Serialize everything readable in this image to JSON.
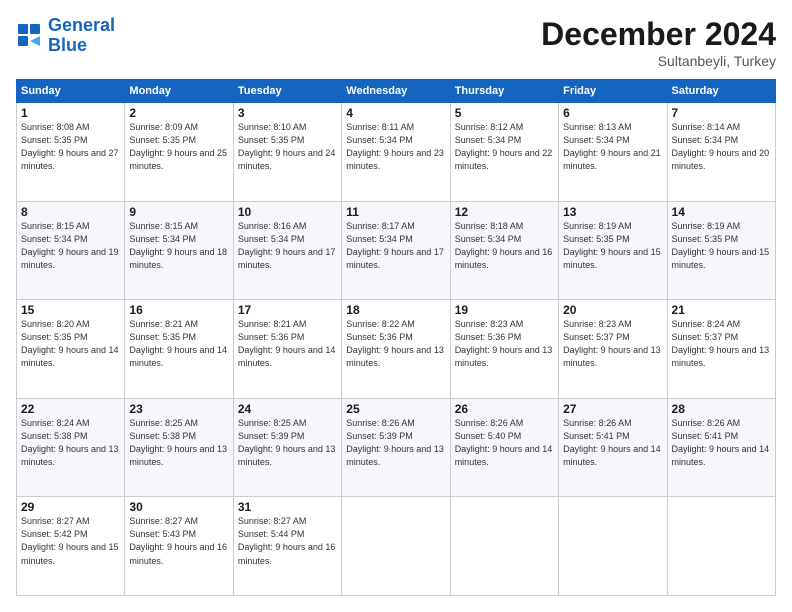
{
  "logo": {
    "line1": "General",
    "line2": "Blue"
  },
  "header": {
    "month_title": "December 2024",
    "subtitle": "Sultanbeyli, Turkey"
  },
  "days_of_week": [
    "Sunday",
    "Monday",
    "Tuesday",
    "Wednesday",
    "Thursday",
    "Friday",
    "Saturday"
  ],
  "weeks": [
    [
      {
        "day": "1",
        "info": "Sunrise: 8:08 AM\nSunset: 5:35 PM\nDaylight: 9 hours and 27 minutes."
      },
      {
        "day": "2",
        "info": "Sunrise: 8:09 AM\nSunset: 5:35 PM\nDaylight: 9 hours and 25 minutes."
      },
      {
        "day": "3",
        "info": "Sunrise: 8:10 AM\nSunset: 5:35 PM\nDaylight: 9 hours and 24 minutes."
      },
      {
        "day": "4",
        "info": "Sunrise: 8:11 AM\nSunset: 5:34 PM\nDaylight: 9 hours and 23 minutes."
      },
      {
        "day": "5",
        "info": "Sunrise: 8:12 AM\nSunset: 5:34 PM\nDaylight: 9 hours and 22 minutes."
      },
      {
        "day": "6",
        "info": "Sunrise: 8:13 AM\nSunset: 5:34 PM\nDaylight: 9 hours and 21 minutes."
      },
      {
        "day": "7",
        "info": "Sunrise: 8:14 AM\nSunset: 5:34 PM\nDaylight: 9 hours and 20 minutes."
      }
    ],
    [
      {
        "day": "8",
        "info": "Sunrise: 8:15 AM\nSunset: 5:34 PM\nDaylight: 9 hours and 19 minutes."
      },
      {
        "day": "9",
        "info": "Sunrise: 8:15 AM\nSunset: 5:34 PM\nDaylight: 9 hours and 18 minutes."
      },
      {
        "day": "10",
        "info": "Sunrise: 8:16 AM\nSunset: 5:34 PM\nDaylight: 9 hours and 17 minutes."
      },
      {
        "day": "11",
        "info": "Sunrise: 8:17 AM\nSunset: 5:34 PM\nDaylight: 9 hours and 17 minutes."
      },
      {
        "day": "12",
        "info": "Sunrise: 8:18 AM\nSunset: 5:34 PM\nDaylight: 9 hours and 16 minutes."
      },
      {
        "day": "13",
        "info": "Sunrise: 8:19 AM\nSunset: 5:35 PM\nDaylight: 9 hours and 15 minutes."
      },
      {
        "day": "14",
        "info": "Sunrise: 8:19 AM\nSunset: 5:35 PM\nDaylight: 9 hours and 15 minutes."
      }
    ],
    [
      {
        "day": "15",
        "info": "Sunrise: 8:20 AM\nSunset: 5:35 PM\nDaylight: 9 hours and 14 minutes."
      },
      {
        "day": "16",
        "info": "Sunrise: 8:21 AM\nSunset: 5:35 PM\nDaylight: 9 hours and 14 minutes."
      },
      {
        "day": "17",
        "info": "Sunrise: 8:21 AM\nSunset: 5:36 PM\nDaylight: 9 hours and 14 minutes."
      },
      {
        "day": "18",
        "info": "Sunrise: 8:22 AM\nSunset: 5:36 PM\nDaylight: 9 hours and 13 minutes."
      },
      {
        "day": "19",
        "info": "Sunrise: 8:23 AM\nSunset: 5:36 PM\nDaylight: 9 hours and 13 minutes."
      },
      {
        "day": "20",
        "info": "Sunrise: 8:23 AM\nSunset: 5:37 PM\nDaylight: 9 hours and 13 minutes."
      },
      {
        "day": "21",
        "info": "Sunrise: 8:24 AM\nSunset: 5:37 PM\nDaylight: 9 hours and 13 minutes."
      }
    ],
    [
      {
        "day": "22",
        "info": "Sunrise: 8:24 AM\nSunset: 5:38 PM\nDaylight: 9 hours and 13 minutes."
      },
      {
        "day": "23",
        "info": "Sunrise: 8:25 AM\nSunset: 5:38 PM\nDaylight: 9 hours and 13 minutes."
      },
      {
        "day": "24",
        "info": "Sunrise: 8:25 AM\nSunset: 5:39 PM\nDaylight: 9 hours and 13 minutes."
      },
      {
        "day": "25",
        "info": "Sunrise: 8:26 AM\nSunset: 5:39 PM\nDaylight: 9 hours and 13 minutes."
      },
      {
        "day": "26",
        "info": "Sunrise: 8:26 AM\nSunset: 5:40 PM\nDaylight: 9 hours and 14 minutes."
      },
      {
        "day": "27",
        "info": "Sunrise: 8:26 AM\nSunset: 5:41 PM\nDaylight: 9 hours and 14 minutes."
      },
      {
        "day": "28",
        "info": "Sunrise: 8:26 AM\nSunset: 5:41 PM\nDaylight: 9 hours and 14 minutes."
      }
    ],
    [
      {
        "day": "29",
        "info": "Sunrise: 8:27 AM\nSunset: 5:42 PM\nDaylight: 9 hours and 15 minutes."
      },
      {
        "day": "30",
        "info": "Sunrise: 8:27 AM\nSunset: 5:43 PM\nDaylight: 9 hours and 16 minutes."
      },
      {
        "day": "31",
        "info": "Sunrise: 8:27 AM\nSunset: 5:44 PM\nDaylight: 9 hours and 16 minutes."
      },
      null,
      null,
      null,
      null
    ]
  ]
}
